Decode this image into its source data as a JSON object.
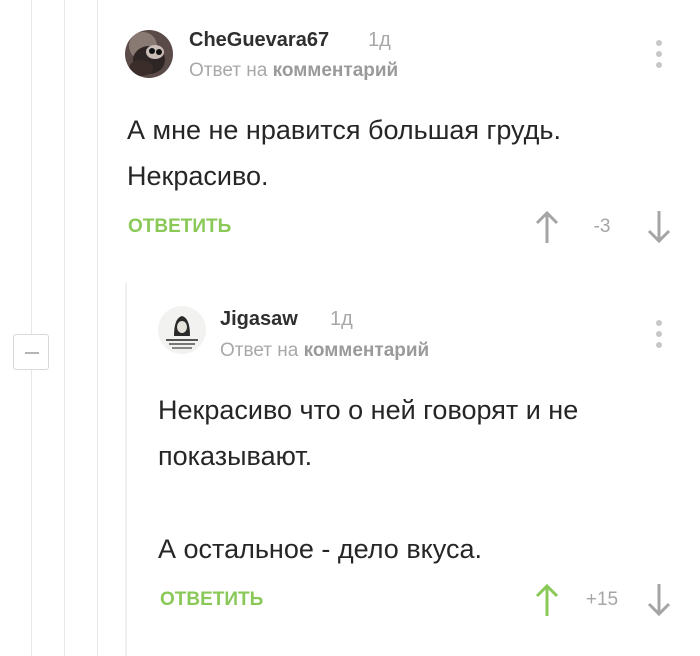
{
  "comments": [
    {
      "nick": "CheGuevara67",
      "time": "1д",
      "reply_prefix": "Ответ на",
      "reply_target": "комментарий",
      "lines": [
        "А мне не нравится большая грудь.",
        "Некрасиво."
      ],
      "reply_label": "ОТВЕТИТЬ",
      "rating": "-3",
      "upvote_color": "#a5a5a5",
      "downvote_color": "#a5a5a5",
      "avatar_icon": "raccoon-avatar"
    },
    {
      "nick": "Jigasaw",
      "time": "1д",
      "reply_prefix": "Ответ на",
      "reply_target": "комментарий",
      "lines": [
        "Некрасиво что о ней говорят и не",
        "показывают.",
        "",
        "А остальное - дело вкуса."
      ],
      "reply_label": "ОТВЕТИТЬ",
      "rating": "+15",
      "upvote_color": "#8ac858",
      "downvote_color": "#a5a5a5",
      "avatar_icon": "engraving-avatar"
    }
  ],
  "colors": {
    "accent": "#8ac858",
    "muted": "#a8a8a8",
    "text": "#262626"
  }
}
